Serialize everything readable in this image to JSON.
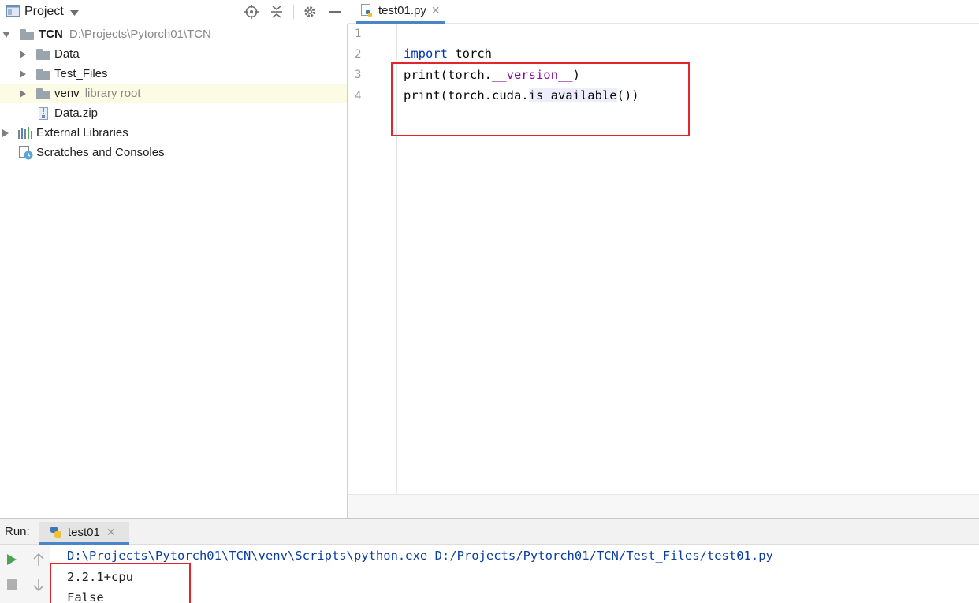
{
  "project_panel": {
    "title": "Project",
    "tree": [
      {
        "label": "TCN",
        "detail": "D:\\Projects\\Pytorch01\\TCN"
      },
      {
        "label": "Data"
      },
      {
        "label": "Test_Files"
      },
      {
        "label": "venv",
        "detail": "library root"
      },
      {
        "label": "Data.zip"
      },
      {
        "label": "External Libraries"
      },
      {
        "label": "Scratches and Consoles"
      }
    ]
  },
  "editor": {
    "tab_label": "test01.py",
    "line_numbers": [
      "1",
      "2",
      "3",
      "4"
    ],
    "code": {
      "l2_kw": "import",
      "l2_rest": " torch",
      "l3_a": "print(torch.",
      "l3_magic": "__version__",
      "l3_b": ")",
      "l4_a": "print(torch.cuda.",
      "l4_hl": "is_available",
      "l4_b": "())"
    }
  },
  "run_panel": {
    "label": "Run:",
    "tab_label": "test01",
    "command": "D:\\Projects\\Pytorch01\\TCN\\venv\\Scripts\\python.exe D:/Projects/Pytorch01/TCN/Test_Files/test01.py",
    "output": [
      "2.2.1+cpu",
      "False"
    ]
  },
  "colors": {
    "keyword": "#0033b3",
    "magic_attr": "#871094",
    "console_command": "#0a3da0",
    "annotation_box": "#e3242b",
    "selection_row": "#fcfbe4",
    "tab_underline": "#4a86c7"
  }
}
